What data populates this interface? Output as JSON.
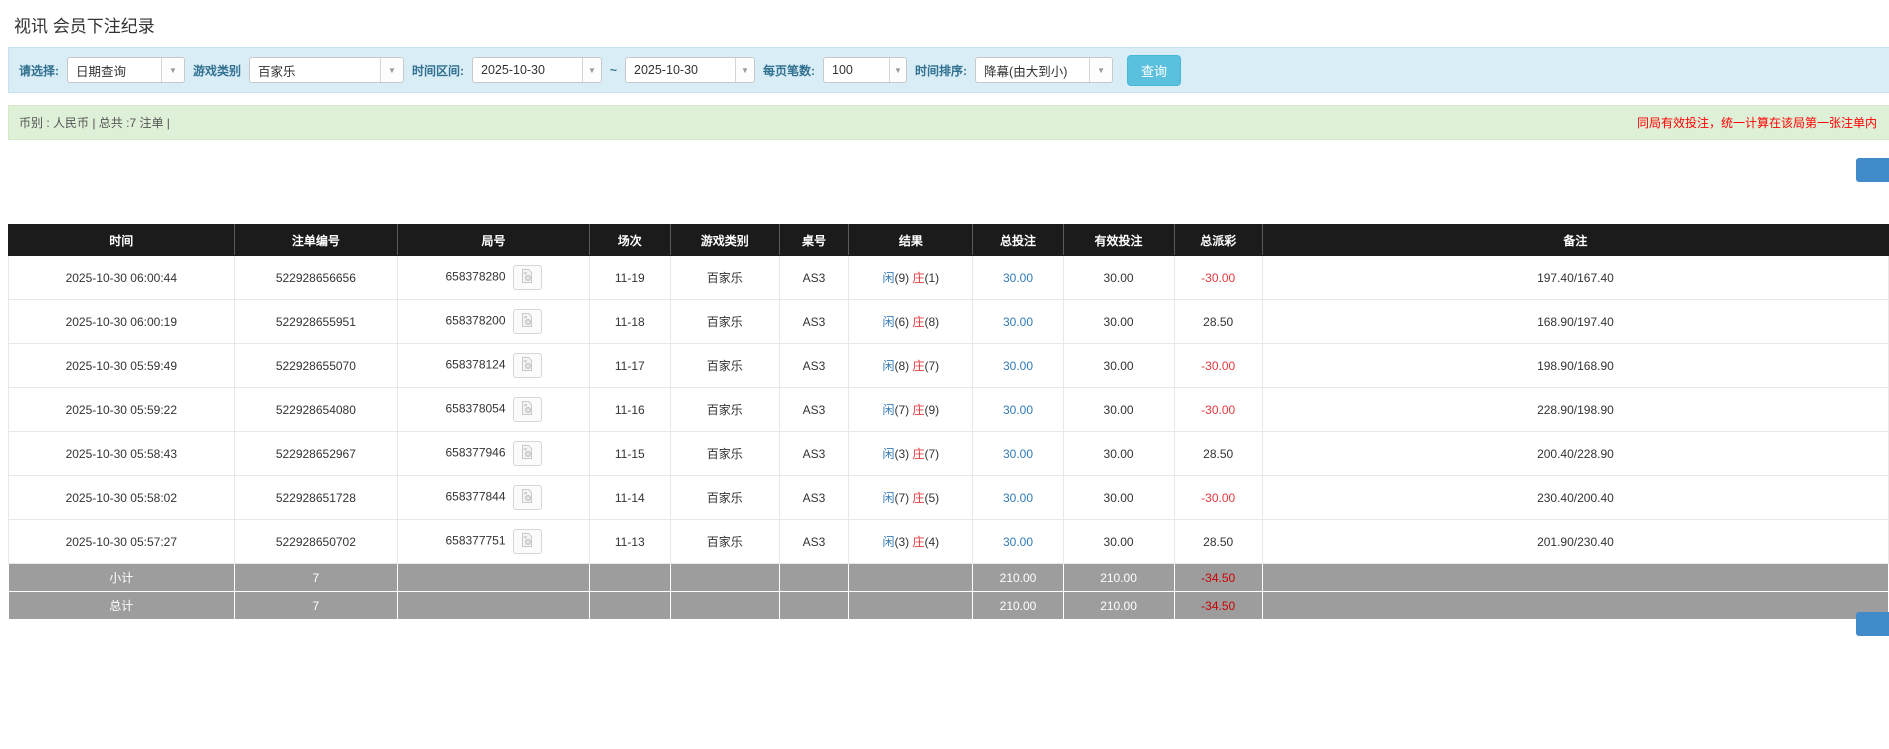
{
  "page": {
    "title": "视讯 会员下注纪录"
  },
  "filters": {
    "select_label": "请选择:",
    "select_value": "日期查询",
    "game_type_label": "游戏类别",
    "game_type_value": "百家乐",
    "time_range_label": "时间区间:",
    "date_from": "2025-10-30",
    "tilde": "~",
    "date_to": "2025-10-30",
    "page_size_label": "每页笔数:",
    "page_size_value": "100",
    "sort_label": "时间排序:",
    "sort_value": "降幕(由大到小)",
    "search_button": "查询"
  },
  "summary": {
    "left": "币别 : 人民币 | 总共 :7 注单 |",
    "right_notice": "同局有效投注，统一计算在该局第一张注单内"
  },
  "table": {
    "headers": [
      "时间",
      "注单编号",
      "局号",
      "场次",
      "游戏类别",
      "桌号",
      "结果",
      "总投注",
      "有效投注",
      "总派彩",
      "备注"
    ],
    "rows": [
      {
        "time": "2025-10-30 06:00:44",
        "bet_id": "522928656656",
        "round_id": "658378280",
        "session": "11-19",
        "game": "百家乐",
        "table_no": "AS3",
        "result": {
          "player_label": "闲",
          "player_score": "(9)",
          "banker_label": "庄",
          "banker_score": "(1)"
        },
        "total_bet": "30.00",
        "valid_bet": "30.00",
        "payout": "-30.00",
        "remark": "197.40/167.40"
      },
      {
        "time": "2025-10-30 06:00:19",
        "bet_id": "522928655951",
        "round_id": "658378200",
        "session": "11-18",
        "game": "百家乐",
        "table_no": "AS3",
        "result": {
          "player_label": "闲",
          "player_score": "(6)",
          "banker_label": "庄",
          "banker_score": "(8)"
        },
        "total_bet": "30.00",
        "valid_bet": "30.00",
        "payout": "28.50",
        "remark": "168.90/197.40"
      },
      {
        "time": "2025-10-30 05:59:49",
        "bet_id": "522928655070",
        "round_id": "658378124",
        "session": "11-17",
        "game": "百家乐",
        "table_no": "AS3",
        "result": {
          "player_label": "闲",
          "player_score": "(8)",
          "banker_label": "庄",
          "banker_score": "(7)"
        },
        "total_bet": "30.00",
        "valid_bet": "30.00",
        "payout": "-30.00",
        "remark": "198.90/168.90"
      },
      {
        "time": "2025-10-30 05:59:22",
        "bet_id": "522928654080",
        "round_id": "658378054",
        "session": "11-16",
        "game": "百家乐",
        "table_no": "AS3",
        "result": {
          "player_label": "闲",
          "player_score": "(7)",
          "banker_label": "庄",
          "banker_score": "(9)"
        },
        "total_bet": "30.00",
        "valid_bet": "30.00",
        "payout": "-30.00",
        "remark": "228.90/198.90"
      },
      {
        "time": "2025-10-30 05:58:43",
        "bet_id": "522928652967",
        "round_id": "658377946",
        "session": "11-15",
        "game": "百家乐",
        "table_no": "AS3",
        "result": {
          "player_label": "闲",
          "player_score": "(3)",
          "banker_label": "庄",
          "banker_score": "(7)"
        },
        "total_bet": "30.00",
        "valid_bet": "30.00",
        "payout": "28.50",
        "remark": "200.40/228.90"
      },
      {
        "time": "2025-10-30 05:58:02",
        "bet_id": "522928651728",
        "round_id": "658377844",
        "session": "11-14",
        "game": "百家乐",
        "table_no": "AS3",
        "result": {
          "player_label": "闲",
          "player_score": "(7)",
          "banker_label": "庄",
          "banker_score": "(5)"
        },
        "total_bet": "30.00",
        "valid_bet": "30.00",
        "payout": "-30.00",
        "remark": "230.40/200.40"
      },
      {
        "time": "2025-10-30 05:57:27",
        "bet_id": "522928650702",
        "round_id": "658377751",
        "session": "11-13",
        "game": "百家乐",
        "table_no": "AS3",
        "result": {
          "player_label": "闲",
          "player_score": "(3)",
          "banker_label": "庄",
          "banker_score": "(4)"
        },
        "total_bet": "30.00",
        "valid_bet": "30.00",
        "payout": "28.50",
        "remark": "201.90/230.40"
      }
    ],
    "subtotal": {
      "label": "小计",
      "count": "7",
      "total_bet": "210.00",
      "valid_bet": "210.00",
      "payout": "-34.50"
    },
    "total": {
      "label": "总计",
      "count": "7",
      "total_bet": "210.00",
      "valid_bet": "210.00",
      "payout": "-34.50"
    }
  },
  "icons": {
    "dropdown_arrow": "▼",
    "video_replay": "video-file-icon"
  },
  "colors": {
    "table_header_bg": "#1b1b1b",
    "filter_bar_bg": "#d9edf7",
    "summary_bar_bg": "#dff0d8",
    "accent_blue": "#337ab7",
    "banker_red": "#e4393c",
    "search_button_teal": "#5bc0de",
    "notice_red": "#ff0000",
    "sum_row_bg": "#9d9d9d",
    "cut_button_blue": "#418bca"
  }
}
